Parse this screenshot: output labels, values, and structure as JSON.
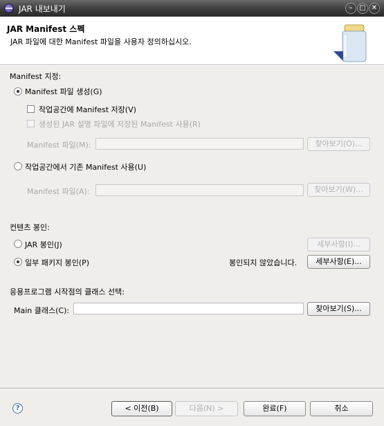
{
  "window": {
    "title": "JAR 내보내기",
    "controls": [
      "minimize-icon",
      "maximize-icon",
      "close-icon"
    ]
  },
  "header": {
    "title": "JAR Manifest 스펙",
    "description": "JAR 파일에 대한 Manifest 파일을 사용자 정의하십시오."
  },
  "manifest_section": {
    "label": "Manifest 지정:",
    "generate_radio": "Manifest 파일 생성(G)",
    "generate_selected": true,
    "save_in_workspace_checkbox": "작업공간에 Manifest 저장(V)",
    "save_in_workspace_checked": false,
    "reuse_checkbox": "생성된 JAR 설명 파일에 저장된 Manifest 사용(R)",
    "reuse_checked": false,
    "manifest_file_label": "Manifest 파일(M):",
    "manifest_file_value": "",
    "browse_button": "찾아보기(O)...",
    "existing_radio": "작업공간에서 기존 Manifest 사용(U)",
    "existing_selected": false,
    "existing_file_label": "Manifest 파일(A):",
    "existing_file_value": "",
    "existing_browse_button": "찾아보기(W)..."
  },
  "seal_section": {
    "label": "컨텐츠 봉인:",
    "seal_jar_radio": "JAR 봉인(J)",
    "seal_jar_selected": false,
    "seal_jar_details_button": "세부사항(I)...",
    "seal_some_radio": "일부 패키지 봉인(P)",
    "seal_some_selected": true,
    "seal_status": "봉인되지 않았습니다.",
    "seal_some_details_button": "세부사항(E)..."
  },
  "entry_section": {
    "label": "응용프로그램 시작점의 클래스 선택:",
    "main_class_label": "Main 클래스(C):",
    "main_class_value": "",
    "browse_button": "찾아보기(S)..."
  },
  "footer": {
    "back_button": "< 이전(B)",
    "next_button": "다음(N) >",
    "finish_button": "완료(F)",
    "cancel_button": "취소"
  },
  "colors": {
    "content_bg": "#efeeeb",
    "titlebar_bg": "#3c3c3c"
  }
}
